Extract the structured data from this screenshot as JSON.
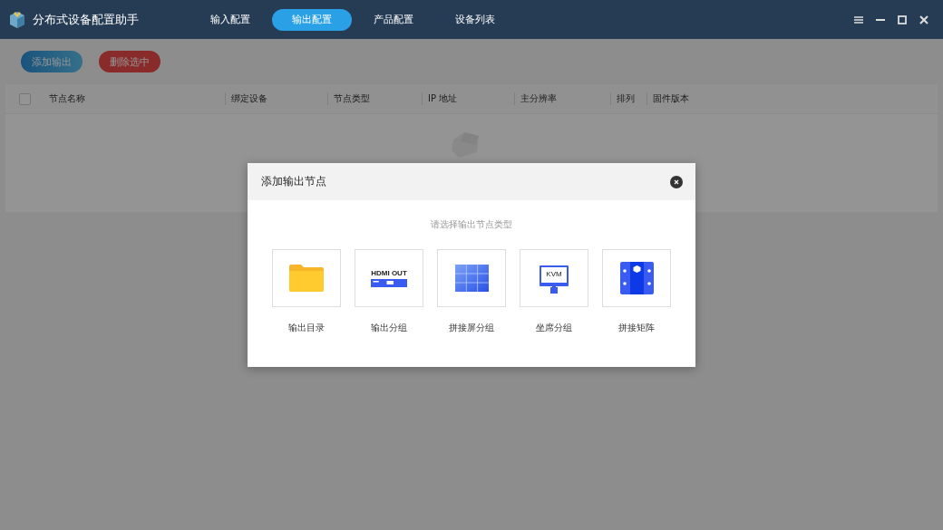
{
  "app": {
    "title": "分布式设备配置助手"
  },
  "tabs": [
    {
      "label": "输入配置",
      "selected": false
    },
    {
      "label": "输出配置",
      "selected": true
    },
    {
      "label": "产品配置",
      "selected": false
    },
    {
      "label": "设备列表",
      "selected": false
    }
  ],
  "toolbar": [
    {
      "label": "添加输出",
      "kind": "primary"
    },
    {
      "label": "删除选中",
      "kind": "danger"
    }
  ],
  "table": {
    "select_all": {
      "checked": false
    },
    "columns": [
      "节点名称",
      "绑定设备",
      "节点类型",
      "IP 地址",
      "主分辨率",
      "排列",
      "固件版本"
    ]
  },
  "dialog": {
    "title": "添加输出节点",
    "hint": "请选择输出节点类型",
    "options": [
      {
        "label": "输出目录",
        "kind": "folder"
      },
      {
        "label": "输出分组",
        "kind": "hdmi",
        "icon_text": "HDMI OUT"
      },
      {
        "label": "拼接屏分组",
        "kind": "videowall"
      },
      {
        "label": "坐席分组",
        "kind": "kvm",
        "icon_text": "KVM"
      },
      {
        "label": "拼接矩阵",
        "kind": "matrix"
      }
    ]
  }
}
